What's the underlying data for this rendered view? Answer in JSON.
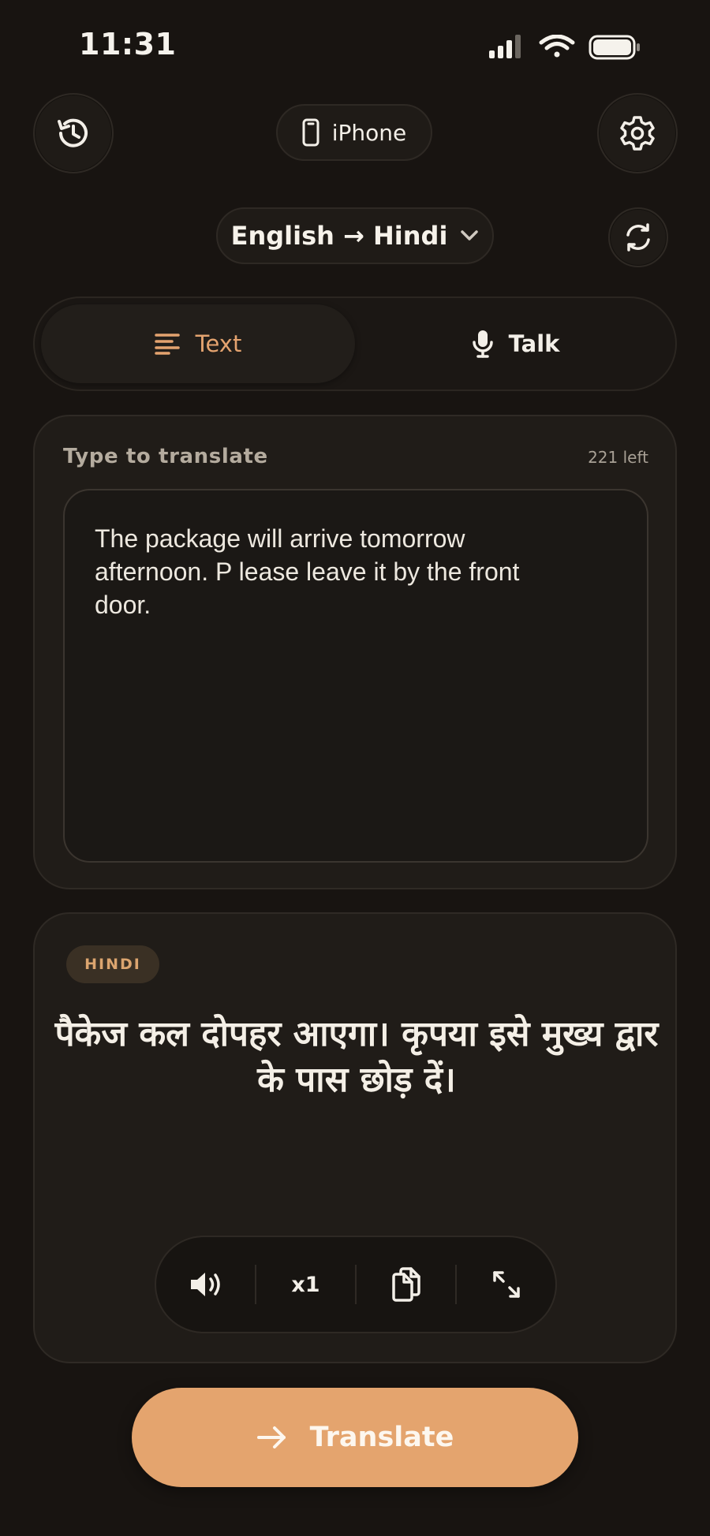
{
  "status_bar": {
    "time": "11:31"
  },
  "header": {
    "history_icon": "history-icon",
    "device_label": "iPhone",
    "settings_icon": "gear-icon"
  },
  "language": {
    "pair_label": "English → Hindi",
    "swap_icon": "refresh-icon"
  },
  "mode_tabs": [
    {
      "label": "Text",
      "icon": "text-lines-icon",
      "active": true
    },
    {
      "label": "Talk",
      "icon": "microphone-icon",
      "active": false
    }
  ],
  "input": {
    "label": "Type to translate",
    "counter": "221 left",
    "value": "The package will arrive tomorrow\nafternoon. P lease leave it by the front\ndoor."
  },
  "output": {
    "language_badge": "HINDI",
    "translated_text": "पैकेज कल दोपहर आएगा। कृपया इसे मुख्य द्वार के पास छोड़ दें।",
    "toolbar": {
      "speaker_icon": "speaker-icon",
      "speed_label": "x1",
      "copy_icon": "copy-icon",
      "expand_icon": "expand-icon"
    }
  },
  "action": {
    "translate_label": "Translate"
  },
  "colors": {
    "background": "#181411",
    "accent": "#e4a46e",
    "card": "#201c18"
  }
}
